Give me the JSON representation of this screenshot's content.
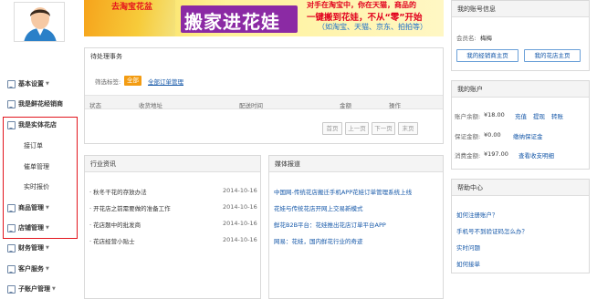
{
  "sidebar": {
    "items": [
      {
        "label": "基本设置",
        "caret": true
      },
      {
        "label": "我是鲜花经销商",
        "caret": false
      },
      {
        "label": "我是实体花店",
        "caret": false
      },
      {
        "label": "商品管理",
        "caret": true
      },
      {
        "label": "店铺管理",
        "caret": true
      },
      {
        "label": "财务管理",
        "caret": true
      },
      {
        "label": "客户服务",
        "caret": true
      },
      {
        "label": "子账户管理",
        "caret": true
      }
    ],
    "sub_items": [
      "接订单",
      "催单管理",
      "实时报价"
    ]
  },
  "banner": {
    "top_small": "去淘宝花盆",
    "headline": "搬家进花娃",
    "line1": "对手在淘宝中，你在天猫，商品的",
    "line2": "一键搬到花娃，不从“零”开始",
    "line3": "（如淘宝、天猫、京东、拍拍等）"
  },
  "pending": {
    "title": "待处理事务",
    "filter_label": "筛选标签:",
    "filter_all": "全部",
    "filter_manage": "全部订单管理",
    "columns": [
      "状态",
      "收货地址",
      "配送时间",
      "金额",
      "操作"
    ],
    "pager": [
      "首页",
      "上一页",
      "下一页",
      "末页"
    ]
  },
  "industry": {
    "title": "行业资讯",
    "rows": [
      {
        "text": "· 秋冬干花的存放办法",
        "date": "2014-10-16"
      },
      {
        "text": "· 开花店之前需要做的准备工作",
        "date": "2014-10-16"
      },
      {
        "text": "· 花店题中的批发商",
        "date": "2014-10-16"
      },
      {
        "text": "· 花店经营小贴士",
        "date": "2014-10-16"
      }
    ]
  },
  "media": {
    "title": "媒体报道",
    "rows": [
      "中国网-传统花店搬迁手机APP花娃订单管理系统上线",
      "花娃与传统花店开网上交易新模式",
      "鲜花B2B平台：花娃推出花店订单平台APP",
      "网易：花娃，国内鲜花行业的奇迹"
    ]
  },
  "account_info": {
    "title": "我的账号信息",
    "member_label": "会员名:",
    "member_name": "梅梅",
    "btn_seller": "我的经销商主页",
    "btn_shop": "我的花店主页"
  },
  "my_account": {
    "title": "我的账户",
    "balance_label": "账户余额:",
    "balance_value": "¥18.00",
    "balance_links": [
      "充值",
      "提现",
      "转账"
    ],
    "deposit_label": "保证金额:",
    "deposit_value": "¥0.00",
    "deposit_link": "缴纳保证金",
    "spent_label": "消费金额:",
    "spent_value": "¥197.00",
    "spent_link": "查看收支明细"
  },
  "help": {
    "title": "帮助中心",
    "links": [
      "如何注册账户？",
      "手机号不到验证码怎么办？",
      "实时问题",
      "如何接单"
    ]
  }
}
